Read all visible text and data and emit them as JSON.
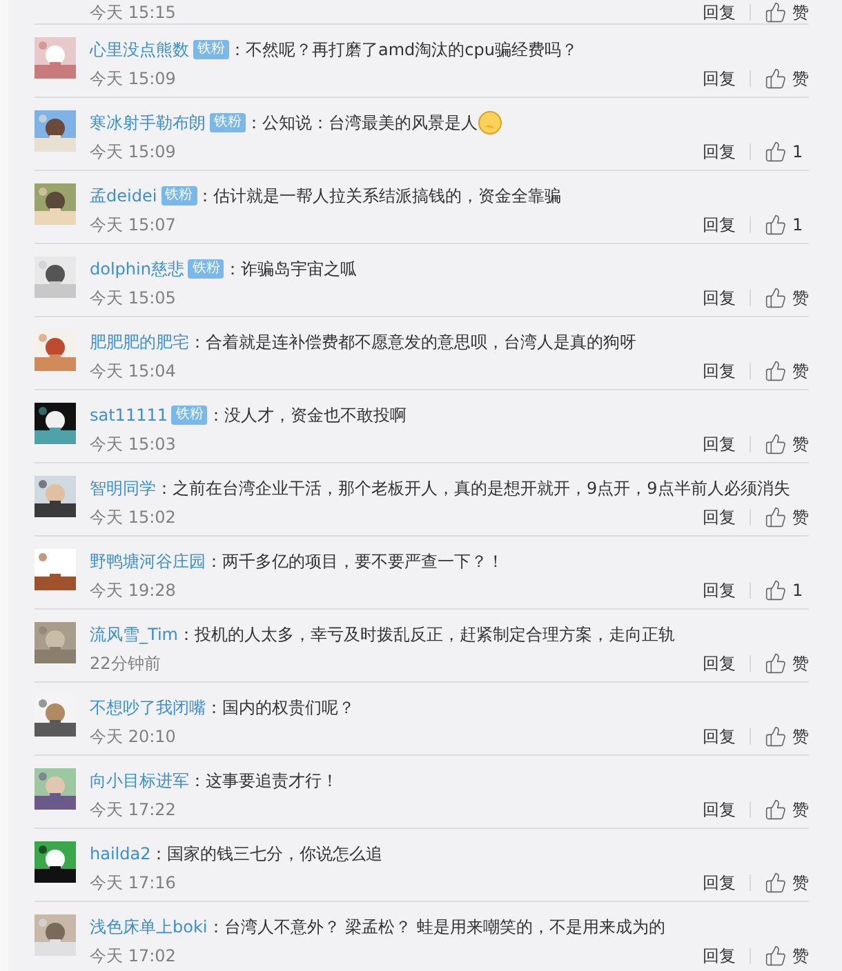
{
  "top_comment": {
    "time": "今天 15:15",
    "reply": "回复",
    "likes": "赞"
  },
  "comments": [
    {
      "name": "心里没点熊数",
      "badge": "铁粉",
      "text": "：不然呢？再打磨了amd淘汰的cpu骗经费吗？",
      "emoji": false,
      "time": "今天 15:09",
      "reply": "回复",
      "likes": "赞"
    },
    {
      "name": "寒冰射手勒布朗",
      "badge": "铁粉",
      "text": "：公知说：台湾最美的风景是人",
      "emoji": true,
      "time": "今天 15:09",
      "reply": "回复",
      "likes": "1"
    },
    {
      "name": "孟deidei",
      "badge": "铁粉",
      "text": "：估计就是一帮人拉关系结派搞钱的，资金全靠骗",
      "emoji": false,
      "time": "今天 15:07",
      "reply": "回复",
      "likes": "1"
    },
    {
      "name": "dolphin慈悲",
      "badge": "铁粉",
      "text": "：诈骗岛宇宙之呱",
      "emoji": false,
      "time": "今天 15:05",
      "reply": "回复",
      "likes": "赞"
    },
    {
      "name": "肥肥肥的肥宅",
      "text": "：合着就是连补偿费都不愿意发的意思呗，台湾人是真的狗呀",
      "emoji": false,
      "time": "今天 15:04",
      "reply": "回复",
      "likes": "赞"
    },
    {
      "name": "sat11111",
      "badge": "铁粉",
      "text": "：没人才，资金也不敢投啊",
      "emoji": false,
      "time": "今天 15:03",
      "reply": "回复",
      "likes": "赞"
    },
    {
      "name": "智明同学",
      "text": "：之前在台湾企业干活，那个老板开人，真的是想开就开，9点开，9点半前人必须消失",
      "emoji": false,
      "time": "今天 15:02",
      "reply": "回复",
      "likes": "赞"
    },
    {
      "name": "野鸭塘河谷庄园",
      "text": "：两千多亿的项目，要不要严查一下？！",
      "emoji": false,
      "time": "今天 19:28",
      "reply": "回复",
      "likes": "1"
    },
    {
      "name": "流风雪_Tim",
      "text": "：投机的人太多，幸亏及时拨乱反正，赶紧制定合理方案，走向正轨",
      "emoji": false,
      "time": "22分钟前",
      "reply": "回复",
      "likes": "赞"
    },
    {
      "name": "不想吵了我闭嘴",
      "text": "：国内的权贵们呢？",
      "emoji": false,
      "time": "今天 20:10",
      "reply": "回复",
      "likes": "赞"
    },
    {
      "name": "向小目标进军",
      "text": "：这事要追责才行！",
      "emoji": false,
      "time": "今天 17:22",
      "reply": "回复",
      "likes": "赞"
    },
    {
      "name": "hailda2",
      "text": "：国家的钱三七分，你说怎么追",
      "emoji": false,
      "time": "今天 17:16",
      "reply": "回复",
      "likes": "赞"
    },
    {
      "name": "浅色床单上boki",
      "text": "：台湾人不意外？ 梁孟松？ 蛙是用来嘲笑的，不是用来成为的",
      "emoji": false,
      "time": "今天 17:02",
      "reply": "回复",
      "likes": "赞"
    }
  ]
}
